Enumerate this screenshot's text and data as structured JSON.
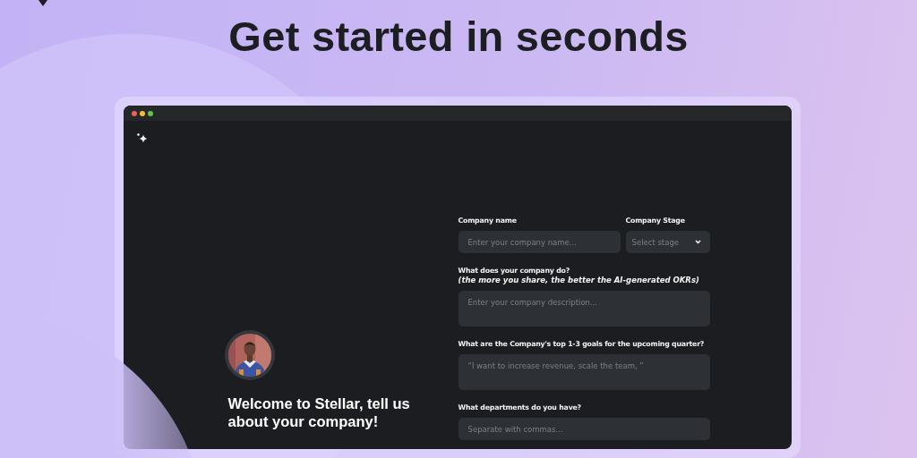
{
  "headline": "Get started in seconds",
  "app": {
    "welcome": "Welcome to Stellar, tell us about your company!",
    "form": [
      {
        "kind": "row",
        "fields": [
          {
            "kind": "input",
            "label": "Company name",
            "placeholder": "Enter your company name..."
          },
          {
            "kind": "select",
            "label": "Company Stage",
            "placeholder": "Select stage"
          }
        ]
      },
      {
        "kind": "textarea",
        "label": "What does your company do?",
        "hint": "(the more you share, the better the AI-generated OKRs)",
        "placeholder": "Enter your company description..."
      },
      {
        "kind": "textarea",
        "label": "What are the Company's top 1-3 goals for the upcoming quarter?",
        "placeholder": "“I want to increase revenue, scale the team, ”"
      },
      {
        "kind": "input",
        "label": "What departments do you have?",
        "placeholder": "Separate with commas..."
      }
    ]
  }
}
